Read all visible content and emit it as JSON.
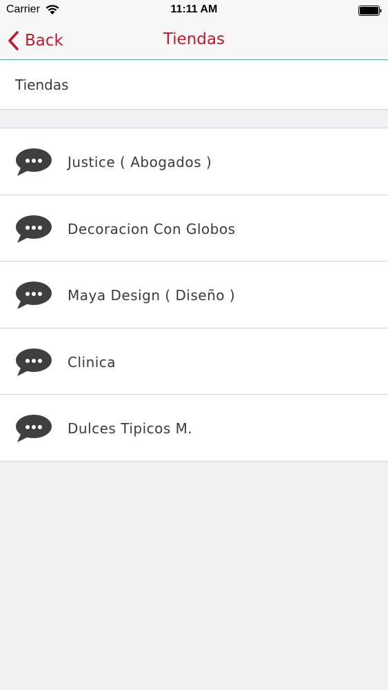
{
  "status_bar": {
    "carrier": "Carrier",
    "time": "11:11 AM"
  },
  "nav_bar": {
    "back_label": "Back",
    "title": "Tiendas"
  },
  "section": {
    "header": "Tiendas"
  },
  "stores": [
    {
      "label": "Justice ( Abogados )",
      "icon": "chat-bubble-icon"
    },
    {
      "label": "Decoracion Con Globos",
      "icon": "chat-bubble-icon"
    },
    {
      "label": "Maya Design ( Diseño )",
      "icon": "chat-bubble-icon"
    },
    {
      "label": "Clinica",
      "icon": "chat-bubble-icon"
    },
    {
      "label": "Dulces Tipicos M.",
      "icon": "chat-bubble-icon"
    }
  ],
  "colors": {
    "accent": "#c2182b",
    "nav_divider": "#3cb9a6",
    "background": "#efeff4",
    "icon": "#3f3f3f"
  }
}
